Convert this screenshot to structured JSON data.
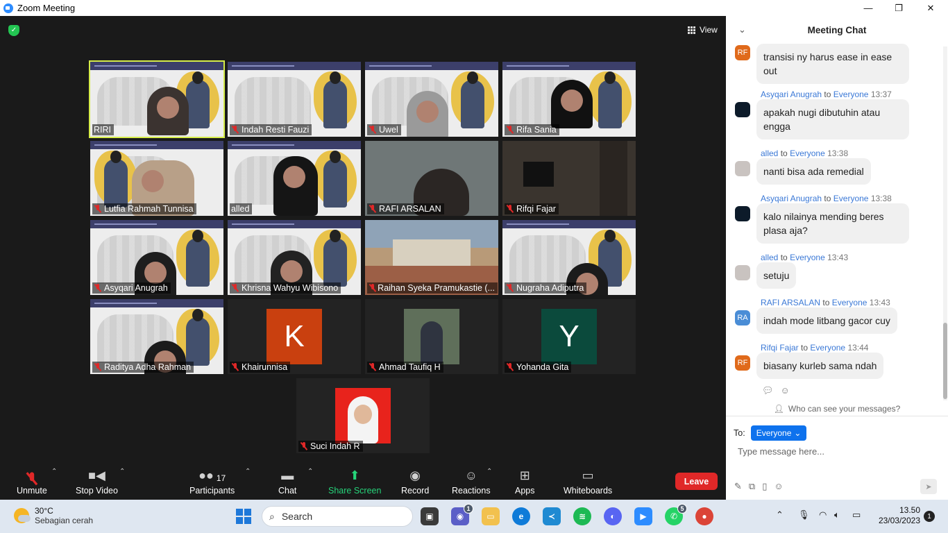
{
  "window": {
    "title": "Zoom Meeting"
  },
  "meeting": {
    "view_label": "View",
    "participants": [
      {
        "name": "RIRI",
        "muted": false,
        "active": true
      },
      {
        "name": "Indah Resti Fauzi",
        "muted": true
      },
      {
        "name": "Uwel",
        "muted": true
      },
      {
        "name": "Rifa Sania",
        "muted": true
      },
      {
        "name": "Lutfia Rahmah Tunnisa",
        "muted": true
      },
      {
        "name": "alled",
        "muted": false
      },
      {
        "name": "RAFI ARSALAN",
        "muted": true
      },
      {
        "name": "Rifqi Fajar",
        "muted": true
      },
      {
        "name": "Asyqari Anugrah",
        "muted": true
      },
      {
        "name": "Khrisna Wahyu Wibisono",
        "muted": true
      },
      {
        "name": "Raihan Syeka Pramukastie (...",
        "muted": true
      },
      {
        "name": "Nugraha Adiputra",
        "muted": true
      },
      {
        "name": "Raditya Adha Rahman",
        "muted": true
      },
      {
        "name": "Khairunnisa",
        "muted": true,
        "initial": "K",
        "color": "#c9400f"
      },
      {
        "name": "Ahmad Taufiq H",
        "muted": true
      },
      {
        "name": "Yohanda Gita",
        "muted": true,
        "initial": "Y",
        "color": "#0b4a3c"
      },
      {
        "name": "Suci Indah R",
        "muted": true
      }
    ]
  },
  "toolbar": {
    "unmute": "Unmute",
    "stop_video": "Stop Video",
    "participants": "Participants",
    "participants_count": "17",
    "chat": "Chat",
    "share_screen": "Share Screen",
    "record": "Record",
    "reactions": "Reactions",
    "apps": "Apps",
    "whiteboards": "Whiteboards",
    "leave": "Leave"
  },
  "chat": {
    "title": "Meeting Chat",
    "to_word": "to",
    "messages": [
      {
        "sender": "",
        "to": "",
        "time": "",
        "text": "transisi ny harus ease in ease out",
        "avatar": "RF"
      },
      {
        "sender": "Asyqari Anugrah",
        "to": "Everyone",
        "time": "13:37",
        "text": "apakah nugi dibutuhin atau engga",
        "avatar": ""
      },
      {
        "sender": "alled",
        "to": "Everyone",
        "time": "13:38",
        "text": "nanti bisa ada remedial",
        "avatar": ""
      },
      {
        "sender": "Asyqari Anugrah",
        "to": "Everyone",
        "time": "13:38",
        "text": "kalo nilainya mending beres plasa aja?",
        "avatar": ""
      },
      {
        "sender": "alled",
        "to": "Everyone",
        "time": "13:43",
        "text": "setuju",
        "avatar": ""
      },
      {
        "sender": "RAFI ARSALAN",
        "to": "Everyone",
        "time": "13:43",
        "text": "indah mode litbang gacor cuy",
        "avatar": "RA"
      },
      {
        "sender": "Rifqi Fajar",
        "to": "Everyone",
        "time": "13:44",
        "text": "biasany kurleb sama ndah",
        "avatar": "RF"
      }
    ],
    "who_can_see": "Who can see your messages?",
    "to_label": "To:",
    "recipient": "Everyone",
    "placeholder": "Type message here..."
  },
  "taskbar": {
    "temperature": "30°C",
    "weather": "Sebagian cerah",
    "search": "Search",
    "time": "13.50",
    "date": "23/03/2023",
    "notifications": "1",
    "badges": {
      "meet": "1",
      "discord": "",
      "whatsapp": "5"
    }
  }
}
